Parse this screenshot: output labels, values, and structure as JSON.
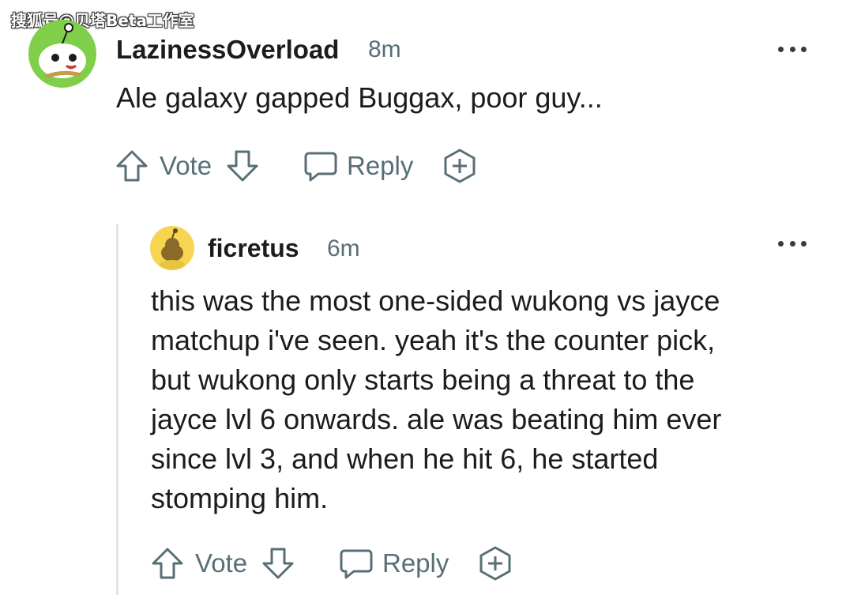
{
  "watermark": "搜狐号@贝塔Beta工作室",
  "comment1": {
    "username": "LazinessOverload",
    "time": "8m",
    "body": "Ale galaxy gapped Buggax, poor guy...",
    "vote_label": "Vote",
    "reply_label": "Reply",
    "avatar_icon": "snoo-avatar-icon"
  },
  "comment2": {
    "username": "ficretus",
    "time": "6m",
    "body_lines": [
      "this was the most one-sided wukong vs jayce",
      "matchup i've seen. yeah it's the counter pick,",
      "but wukong only starts being a threat to the",
      "jayce lvl 6 onwards. ale was beating him ever",
      "since lvl 3, and when he hit 6, he started",
      "stomping him."
    ],
    "vote_label": "Vote",
    "reply_label": "Reply",
    "avatar_icon": "snoo-avatar-icon"
  },
  "colors": {
    "meta": "#576f76",
    "text": "#1c1c1c",
    "avatar1_bg": "#7fcf4a",
    "avatar2_bg": "#f7d452",
    "thread_line": "#e2e4e6"
  }
}
